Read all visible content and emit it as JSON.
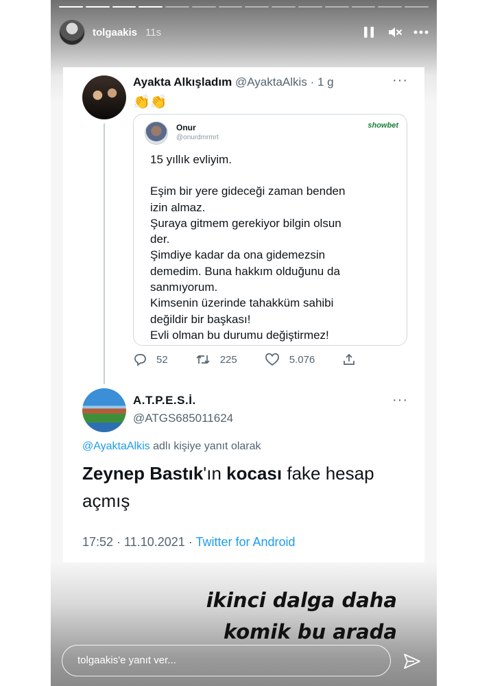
{
  "story": {
    "segments": 14,
    "active_segment": 4,
    "username": "tolgaakis",
    "time_ago": "11s",
    "caption_line1": "ikinci dalga daha",
    "caption_line2": "komik bu arada",
    "reply_placeholder": "tolgaakis'e yanıt ver..."
  },
  "quote_tweet": {
    "name": "Ayakta Alkışladım",
    "handle": "@AyaktaAlkis",
    "time": "· 1 g",
    "emoji": "👏👏",
    "inner": {
      "name": "Onur",
      "handle": "@onurdmrmrt",
      "logo": "showbet",
      "lines": [
        "15 yıllık evliyim.",
        "",
        "Eşim bir yere gideceği zaman benden",
        "izin almaz.",
        "Şuraya gitmem gerekiyor bilgin olsun",
        "der.",
        "Şimdiye kadar da ona gidemezsin",
        "demedim. Buna hakkım olduğunu da",
        "sanmıyorum.",
        "Kimsenin üzerinde tahakküm sahibi",
        "değildir bir başkası!",
        "Evli olman bu durumu değiştirmez!"
      ]
    },
    "replies": "52",
    "retweets": "225",
    "likes": "5.076"
  },
  "reply_tweet": {
    "name": "A.T.P.E.S.İ.",
    "handle": "@ATGS685011624",
    "replying_mention": "@AyaktaAlkis",
    "replying_suffix": "adlı kişiye yanıt olarak",
    "text_bold1": "Zeynep Bastık",
    "text_part2": "'ın ",
    "text_bold2": "kocası",
    "text_part3": " fake hesap açmış",
    "time": "17:52 · 11.10.2021 ·",
    "source": "Twitter for Android"
  }
}
